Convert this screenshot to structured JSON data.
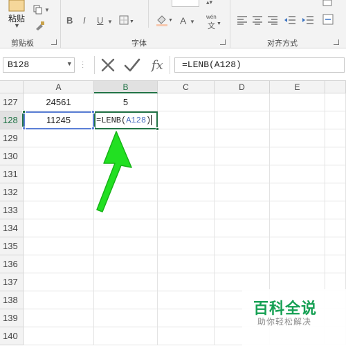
{
  "ribbon": {
    "paste_label": "粘贴",
    "clipboard_label": "剪贴板",
    "font_label": "字体",
    "align_label": "对齐方式",
    "bold": "B",
    "italic": "I",
    "underline": "U",
    "font_color": "A",
    "wen_label": "wén",
    "wen_char": "文"
  },
  "formula_bar": {
    "name_box": "B128",
    "formula": "=LENB(A128)"
  },
  "grid": {
    "columns": [
      "A",
      "B",
      "C",
      "D",
      "E"
    ],
    "selected_column": "B",
    "rows": [
      "127",
      "128",
      "129",
      "130",
      "131",
      "132",
      "133",
      "134",
      "135",
      "136",
      "137",
      "138",
      "139",
      "140"
    ],
    "selected_row": "128",
    "cells": {
      "A127": "24561",
      "B127": "5",
      "A128": "11245"
    },
    "active_edit": {
      "prefix": "=LENB(",
      "ref": "A128",
      "suffix": ")"
    }
  },
  "watermark": {
    "title": "百科全说",
    "subtitle": "助你轻松解决"
  },
  "colors": {
    "excel_green": "#217346",
    "reference_blue": "#4a6fbf",
    "arrow_green": "#22e022",
    "watermark_green": "#15a053"
  }
}
